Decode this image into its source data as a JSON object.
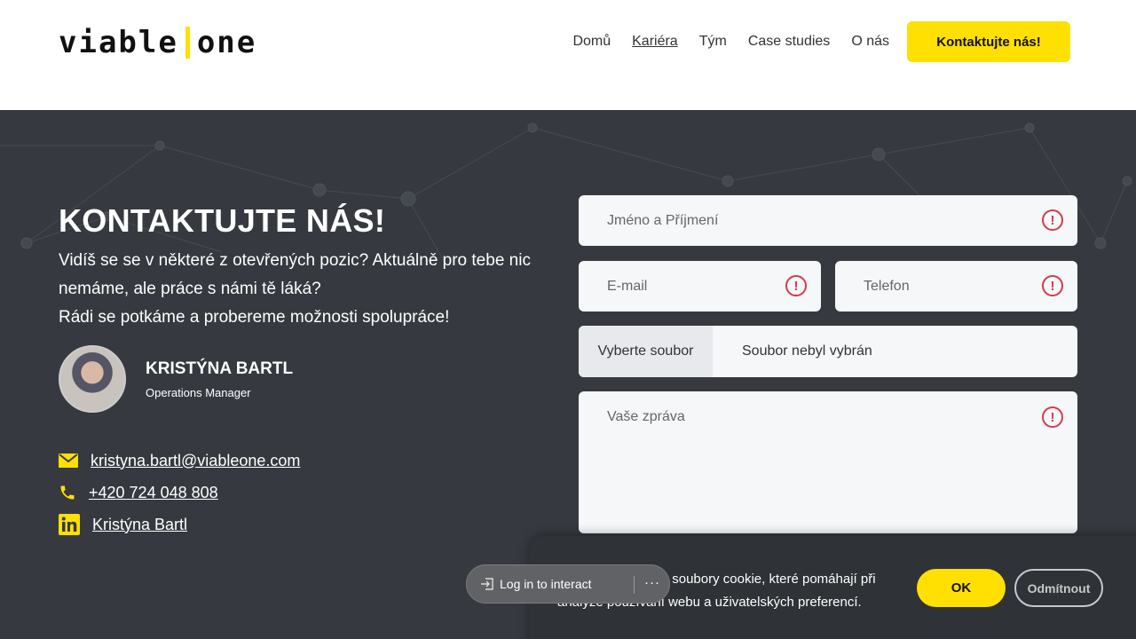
{
  "brand": {
    "logo_left": "viable",
    "logo_right": "one",
    "accent": "#ffe000"
  },
  "nav": {
    "items": [
      {
        "label": "Domů"
      },
      {
        "label": "Kariéra",
        "active": true
      },
      {
        "label": "Tým"
      },
      {
        "label": "Case studies"
      },
      {
        "label": "O nás"
      }
    ],
    "cta_label": "Kontaktujte nás!"
  },
  "contact": {
    "title": "KONTAKTUJTE NÁS!",
    "intro_line1": "Vidíš se se v některé z otevřených pozic? Aktuálně pro tebe nic nemáme, ale práce s námi tě láká?",
    "intro_line2": "Rádi se potkáme a probereme možnosti spolupráce!",
    "person": {
      "name": "KRISTÝNA BARTL",
      "role": "Operations Manager"
    },
    "email": "kristyna.bartl@viableone.com",
    "phone": "+420 724 048 808",
    "linkedin": "Kristýna Bartl"
  },
  "form": {
    "name_placeholder": "Jméno a Příjmení",
    "email_placeholder": "E-mail",
    "phone_placeholder": "Telefon",
    "file_button": "Vyberte soubor",
    "file_status": "Soubor nebyl vybrán",
    "message_placeholder": "Vaše zpráva",
    "error_color": "#d63a4a"
  },
  "cookie": {
    "text": "Tento web používá soubory cookie, které pomáhají při analýze používání webu a uživatelských preferencí.",
    "ok_label": "OK",
    "deny_label": "Odmítnout"
  },
  "overlay": {
    "login_label": "Log in to interact",
    "more_label": "···"
  }
}
